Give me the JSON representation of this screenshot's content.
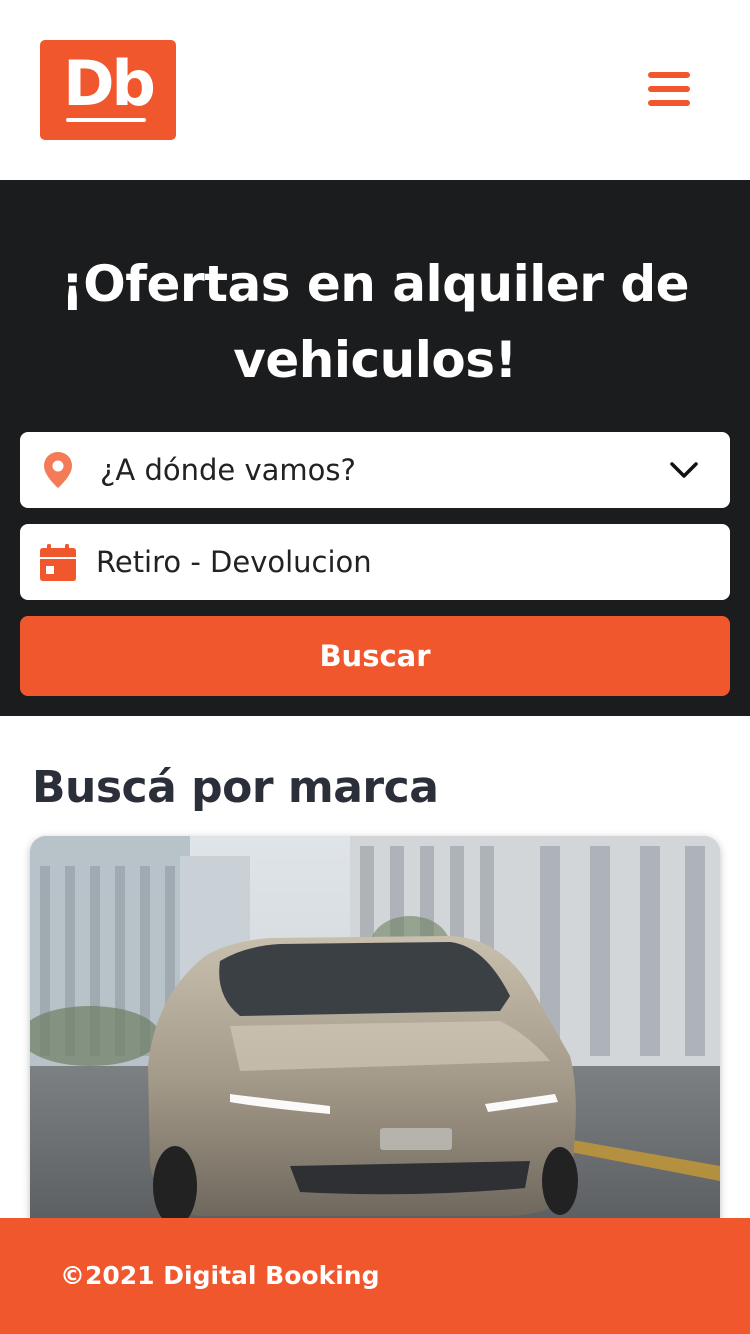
{
  "header": {
    "logo_text": "Db",
    "menu_icon": "hamburger-menu-icon"
  },
  "hero": {
    "title": "¡Ofertas en alquiler de vehiculos!",
    "location_placeholder": "¿A dónde vamos?",
    "location_icon": "location-pin-icon",
    "dropdown_icon": "chevron-down-icon",
    "dates_label": "Retiro - Devolucion",
    "dates_icon": "calendar-icon",
    "search_button": "Buscar"
  },
  "brands": {
    "section_title": "Buscá por marca"
  },
  "footer": {
    "copyright": "©2021 Digital Booking"
  },
  "colors": {
    "accent": "#f0572d",
    "hero_background": "#1b1c1e",
    "title_text": "#2b2f3a"
  }
}
